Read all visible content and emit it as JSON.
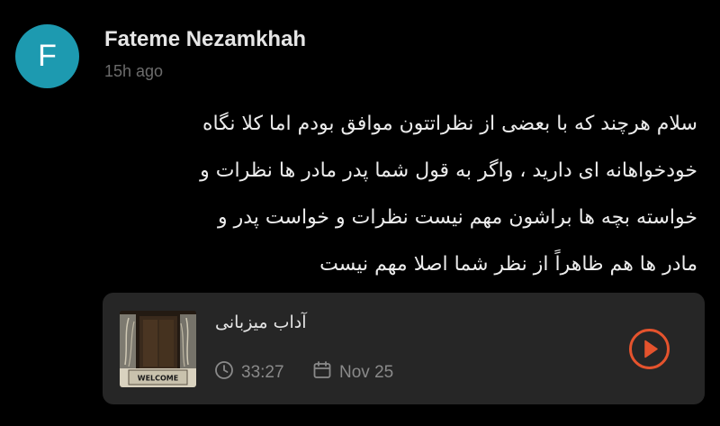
{
  "comment_author": {
    "avatar_initial": "F",
    "avatar_color": "#1d9ab0",
    "name": "Fateme Nezamkhah",
    "time_ago": "15h ago"
  },
  "comment": {
    "lines": [
      "سلام هرچند که با بعضی از نظراتتون موافق بودم اما کلا نگاه",
      "خودخواهانه ای دارید ، واگر به قول شما پدر مادر ها نظرات و",
      "خواسته بچه ها براشون مهم نیست نظرات و خواست پدر و",
      "مادر ها هم ظاهراً از نظر شما اصلا مهم نیست"
    ]
  },
  "episode_card": {
    "thumbnail_text": "WELCOME",
    "title": "آداب میزبانی",
    "duration": "33:27",
    "date": "Nov 25",
    "duration_icon": "clock-icon",
    "date_icon": "calendar-icon",
    "play_icon": "play-circle-icon",
    "accent_color": "#e5532d"
  }
}
